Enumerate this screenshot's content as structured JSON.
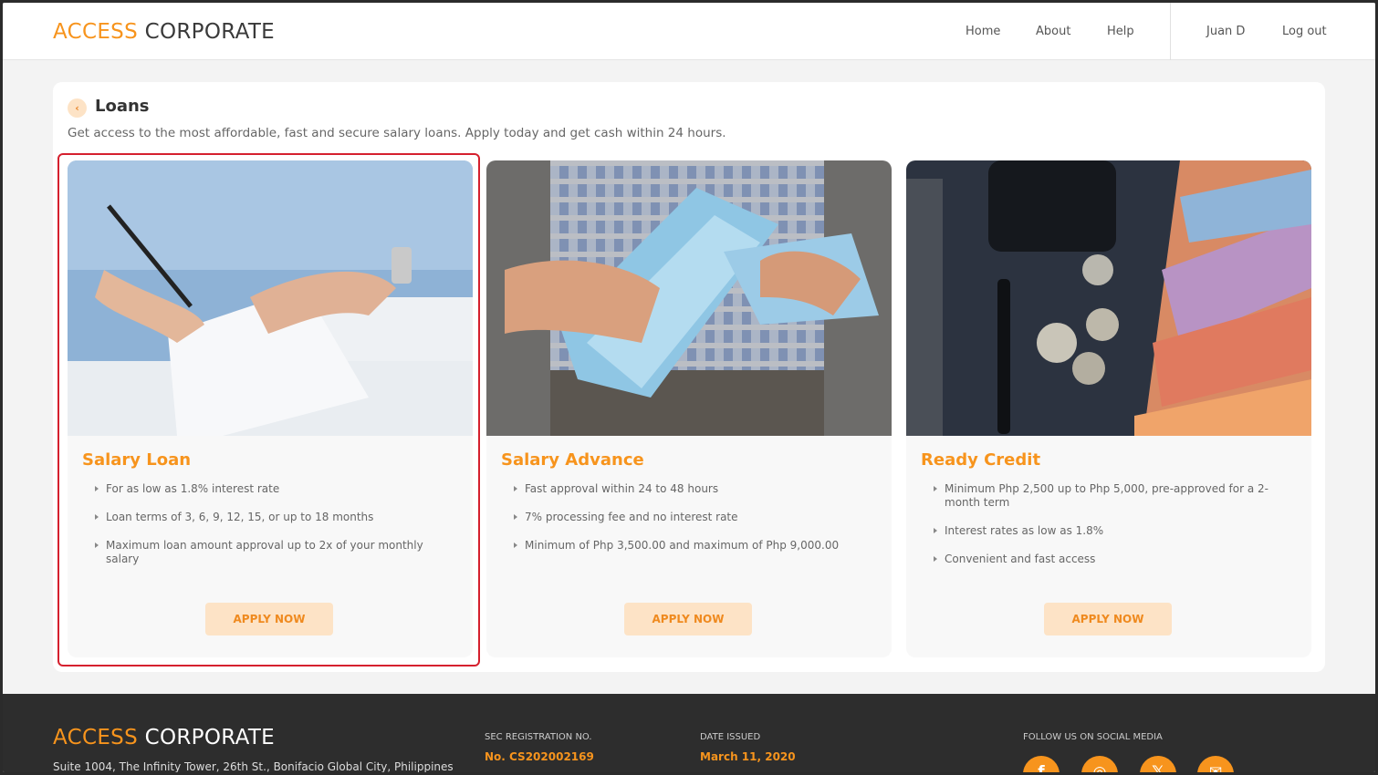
{
  "brand": {
    "logo_part1": "ACCESS",
    "logo_part2": "CORPORATE",
    "accent_color": "#f7941d"
  },
  "nav": {
    "home": "Home",
    "about": "About",
    "help": "Help",
    "user": "Juan D",
    "logout": "Log out"
  },
  "page": {
    "title": "Loans",
    "subtitle": "Get access to the most affordable, fast and secure salary loans. Apply today and get cash within 24 hours."
  },
  "cards": [
    {
      "title": "Salary Loan",
      "bullets": [
        "For as low as 1.8% interest rate",
        "Loan terms of 3, 6, 9, 12, 15, or up to 18 months",
        "Maximum loan amount approval up to 2x of your monthly salary"
      ],
      "button": "APPLY NOW"
    },
    {
      "title": "Salary Advance",
      "bullets": [
        "Fast approval within 24 to 48 hours",
        "7% processing fee and no interest rate",
        "Minimum of Php 3,500.00 and maximum of Php 9,000.00"
      ],
      "button": "APPLY NOW"
    },
    {
      "title": "Ready Credit",
      "bullets": [
        "Minimum Php 2,500 up to Php 5,000, pre-approved for a 2-month term",
        "Interest rates as low as 1.8%",
        "Convenient and fast access"
      ],
      "button": "APPLY NOW"
    }
  ],
  "footer": {
    "address": "Suite 1004, The Infinity Tower, 26th St., Bonifacio Global City, Philippines",
    "sec_label": "SEC REGISTRATION NO.",
    "sec_value": "No. CS202002169",
    "date_label": "DATE ISSUED",
    "date_value": "March 11, 2020",
    "social_label": "FOLLOW US ON SOCIAL MEDIA",
    "social_icons": [
      "facebook-icon",
      "instagram-icon",
      "x-icon",
      "email-icon"
    ]
  }
}
